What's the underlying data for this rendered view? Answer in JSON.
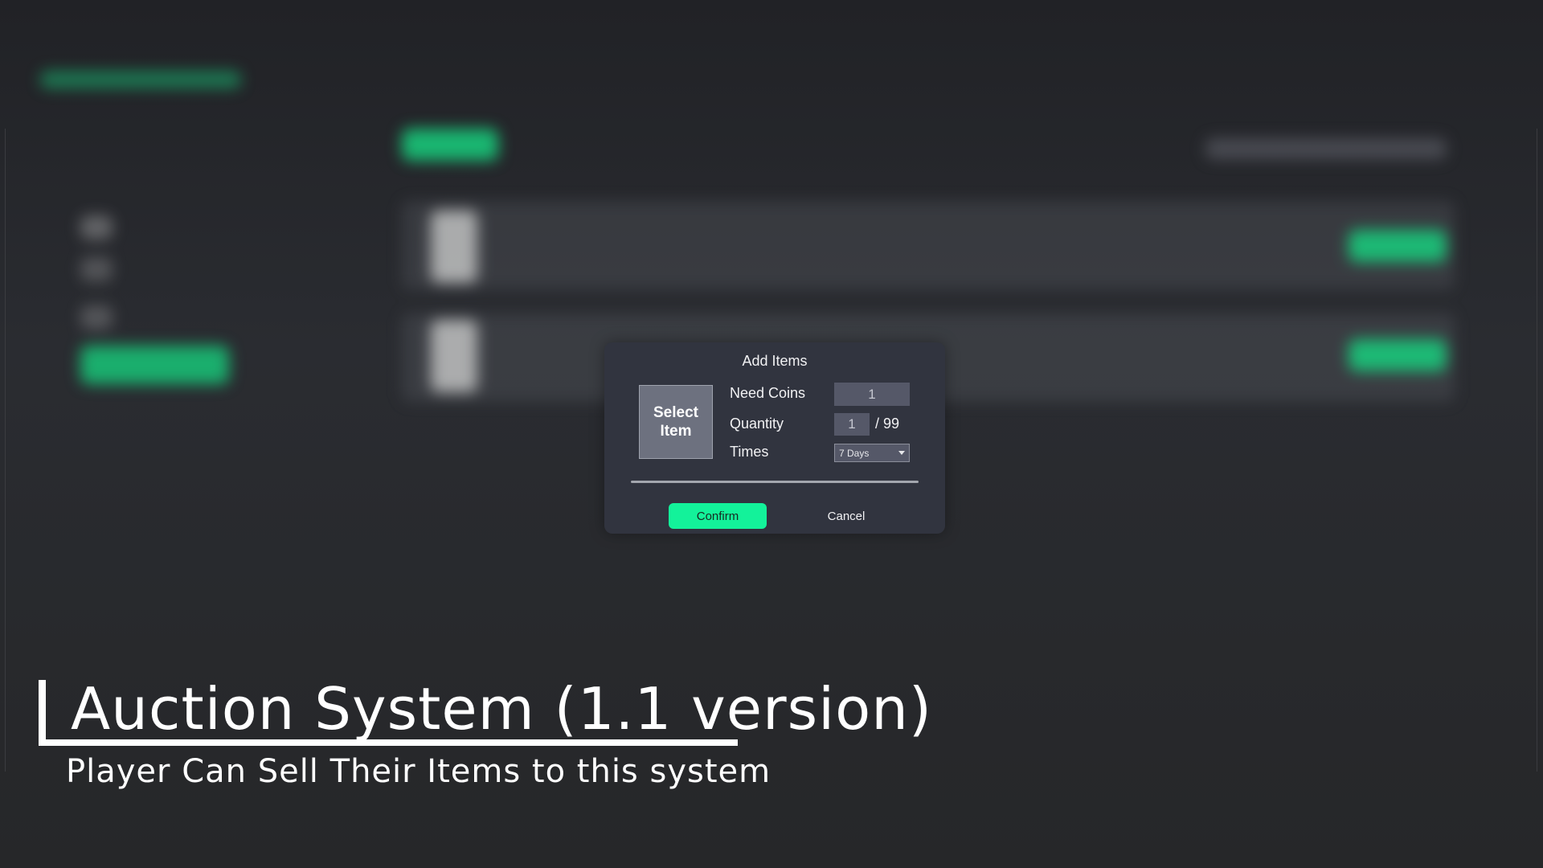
{
  "dialog": {
    "title": "Add Items",
    "select_item_label": "Select\nItem",
    "need_coins_label": "Need Coins",
    "need_coins_value": "1",
    "quantity_label": "Quantity",
    "quantity_value": "1",
    "quantity_max": "/ 99",
    "times_label": "Times",
    "times_value": "7 Days",
    "confirm_label": "Confirm",
    "cancel_label": "Cancel"
  },
  "caption": {
    "title": "Auction System (1.1 version)",
    "subtitle": "Player Can Sell Their Items to this system"
  },
  "colors": {
    "accent": "#13f29a",
    "dialog_bg": "#31343f",
    "input_bg": "#555868"
  }
}
